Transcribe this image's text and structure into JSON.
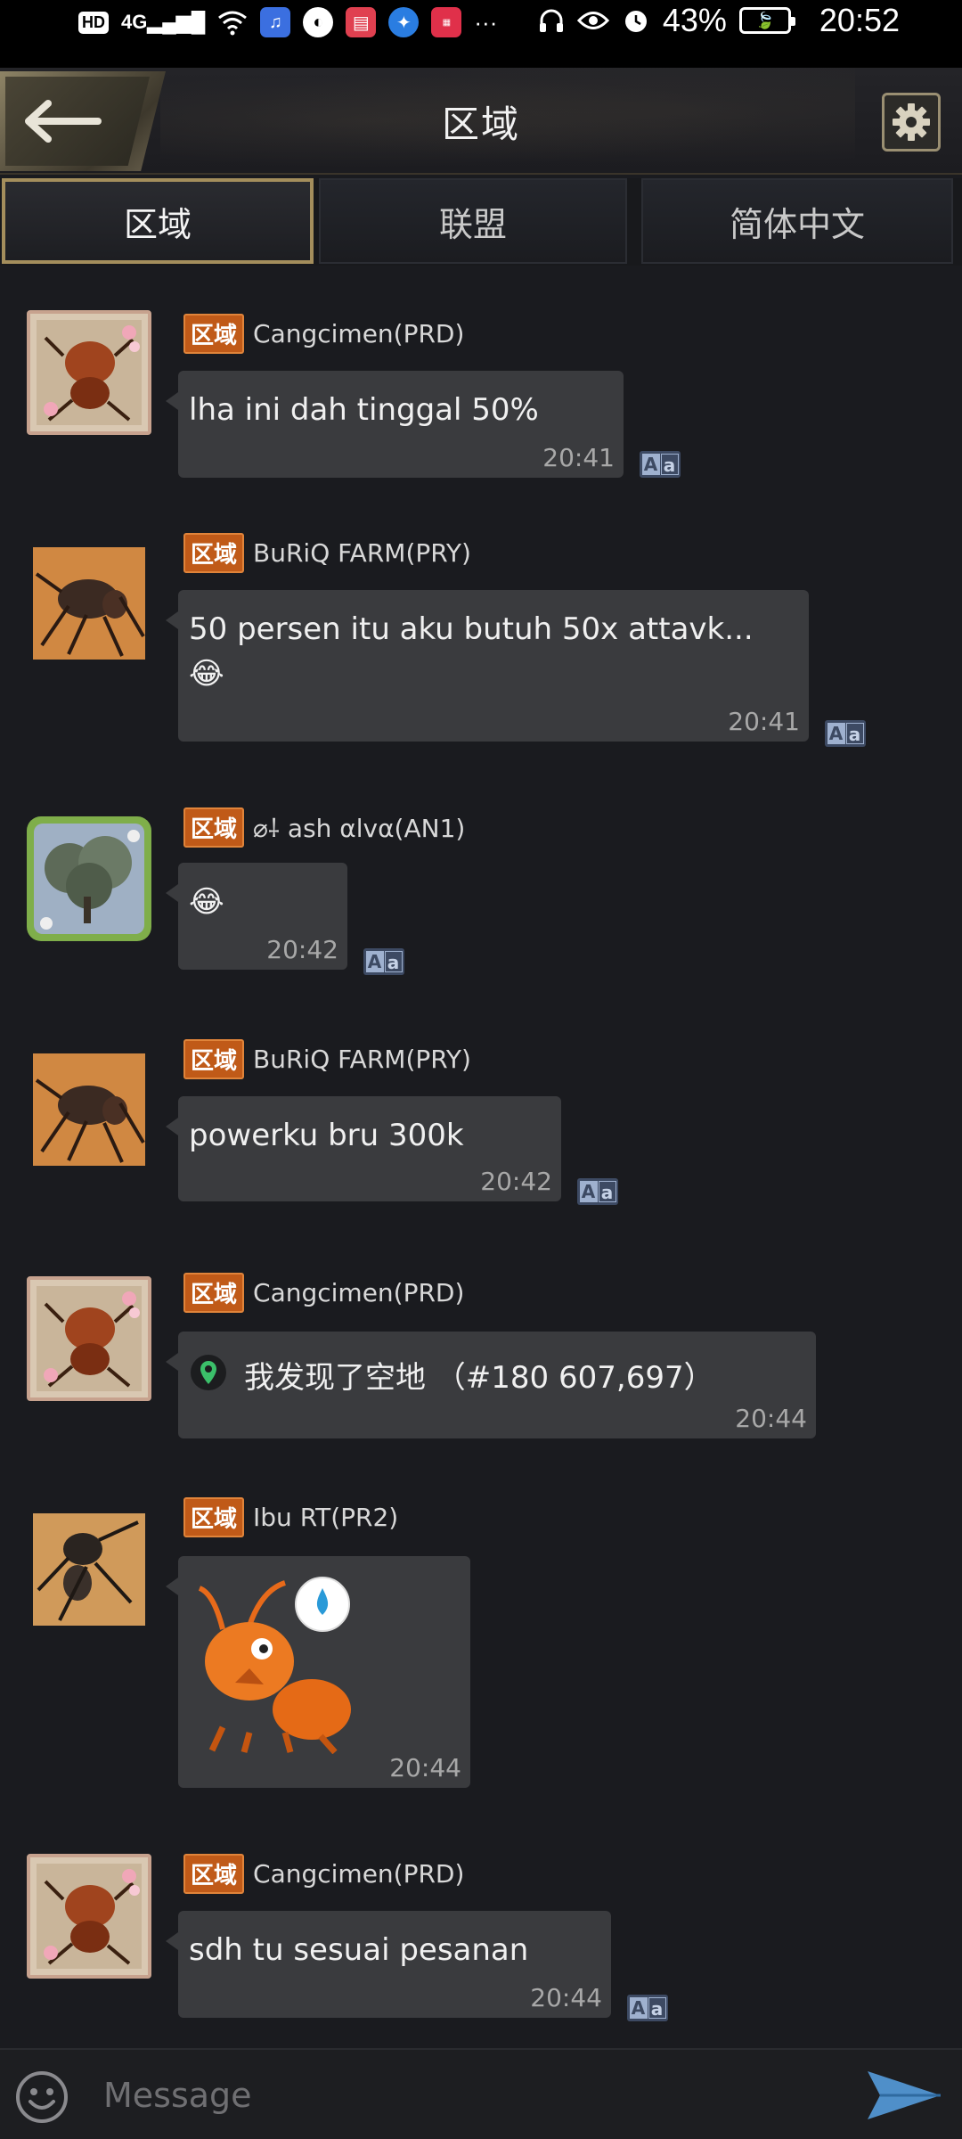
{
  "status_bar": {
    "network": "4G",
    "battery": "43%",
    "time": "20:52",
    "hd": "HD",
    "more": "···"
  },
  "header": {
    "title": "区域"
  },
  "tabs": [
    {
      "label": "区域",
      "active": true
    },
    {
      "label": "联盟",
      "active": false
    },
    {
      "label": "简体中文",
      "active": false
    }
  ],
  "messages": [
    {
      "badge": "区域",
      "sender": "Cangcimen(PRD)",
      "text": "lha ini dah tinggal 50%",
      "time": "20:41"
    },
    {
      "badge": "区域",
      "sender": "BuRiQ  FARM(PRY)",
      "text": "50 persen itu aku butuh 50x attavk...",
      "emoji": "😂",
      "time": "20:41"
    },
    {
      "badge": "区域",
      "sender": "⌀⸸ ash αlvα(AN1)",
      "emoji": "😂",
      "time": "20:42"
    },
    {
      "badge": "区域",
      "sender": "BuRiQ  FARM(PRY)",
      "text": "powerku bru 300k",
      "time": "20:42"
    },
    {
      "badge": "区域",
      "sender": "Cangcimen(PRD)",
      "text": "我发现了空地 （#180 607,697）",
      "time": "20:44"
    },
    {
      "badge": "区域",
      "sender": "Ibu RT(PR2)",
      "time": "20:44"
    },
    {
      "badge": "区域",
      "sender": "Cangcimen(PRD)",
      "text": "sdh tu sesuai pesanan",
      "time": "20:44"
    }
  ],
  "input": {
    "placeholder": "Message"
  },
  "colors": {
    "accent_gold": "#a48e5c",
    "badge_orange": "#c05a18",
    "bubble": "#3a3b3e",
    "background": "#1a1b1f"
  },
  "icons": {
    "back": "back-arrow-icon",
    "settings": "gear-icon",
    "translate": "translate-icon",
    "location": "location-pin-icon",
    "emoji": "emoji-icon",
    "send": "send-icon"
  }
}
